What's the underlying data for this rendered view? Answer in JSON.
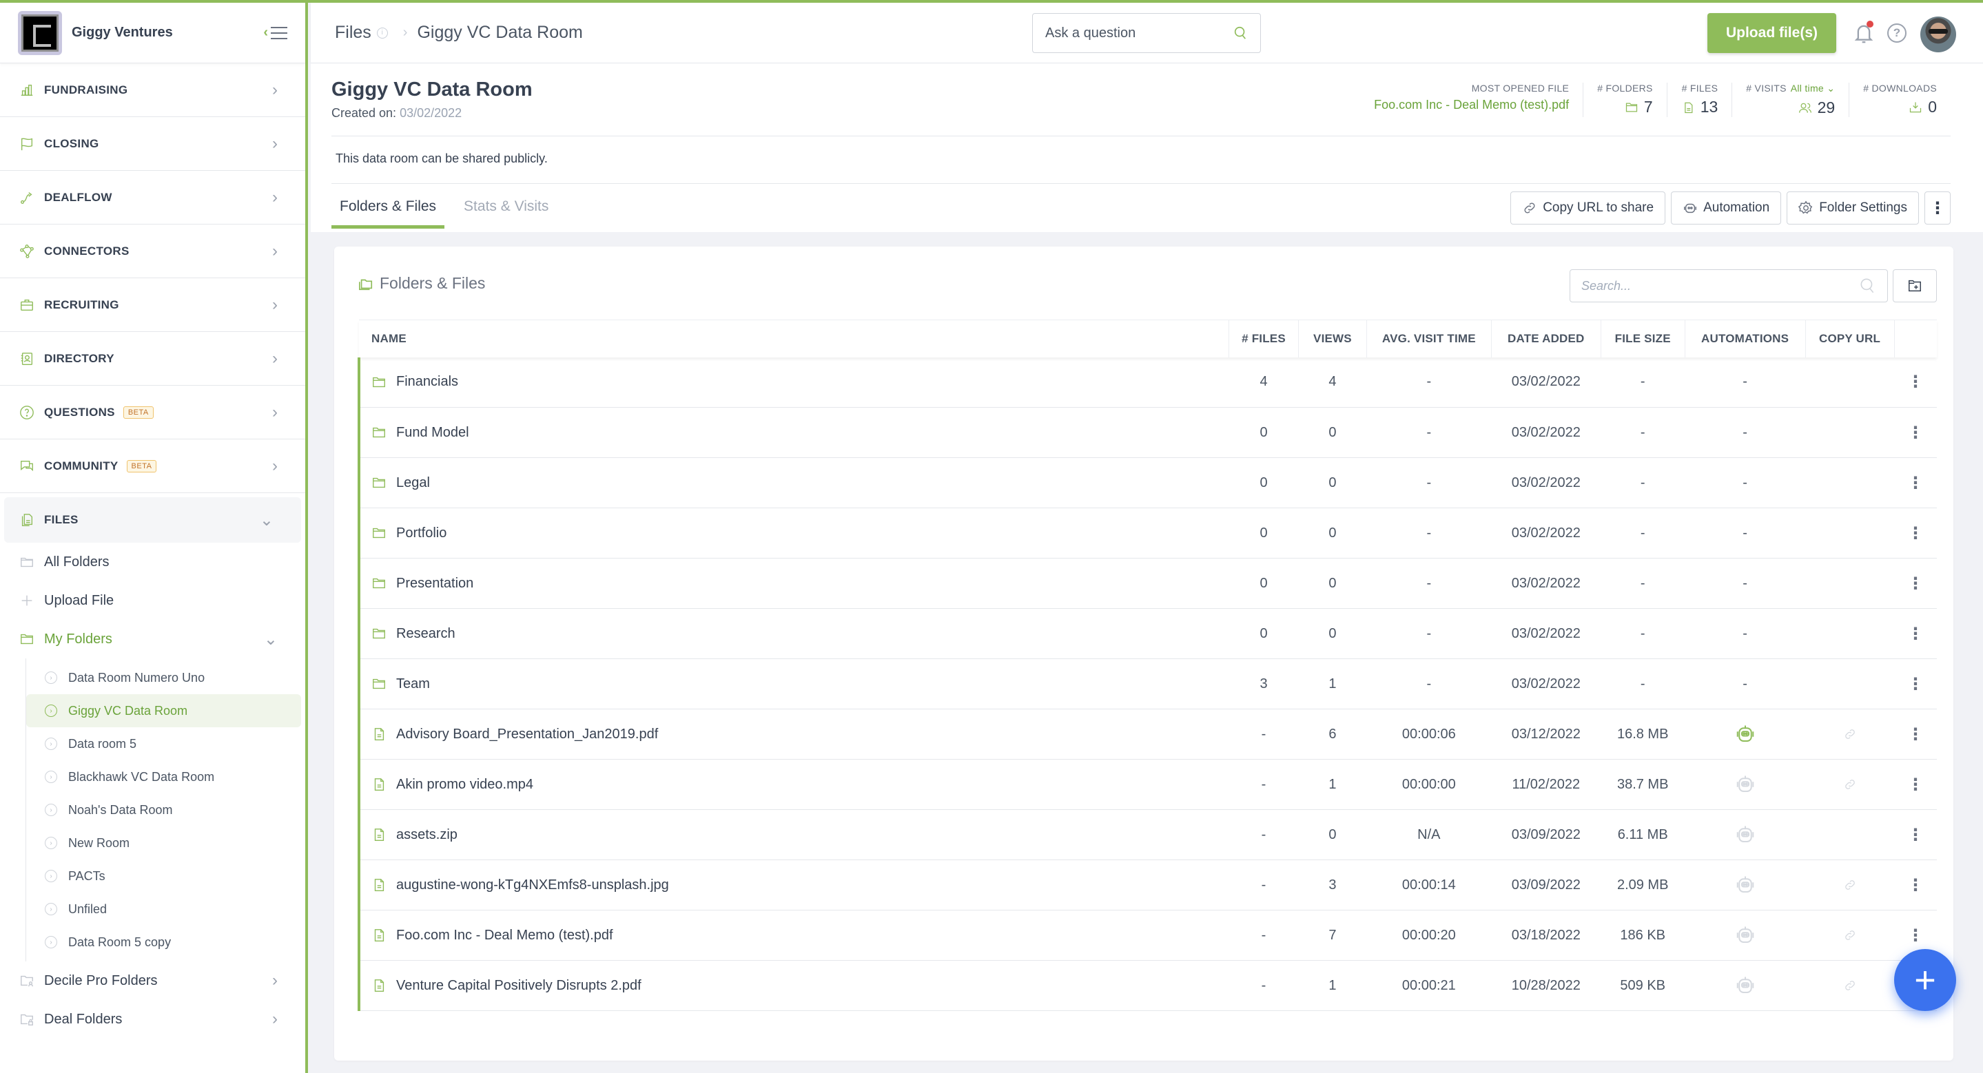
{
  "brand": {
    "name": "Giggy Ventures"
  },
  "sidebar": {
    "nav": [
      {
        "label": "FUNDRAISING",
        "icon": "bar-chart-icon"
      },
      {
        "label": "CLOSING",
        "icon": "flag-icon"
      },
      {
        "label": "DEALFLOW",
        "icon": "route-icon"
      },
      {
        "label": "CONNECTORS",
        "icon": "network-icon"
      },
      {
        "label": "RECRUITING",
        "icon": "briefcase-icon"
      },
      {
        "label": "DIRECTORY",
        "icon": "contact-book-icon"
      },
      {
        "label": "QUESTIONS",
        "icon": "question-circle-icon",
        "badge": "BETA"
      },
      {
        "label": "COMMUNITY",
        "icon": "chat-icon",
        "badge": "BETA"
      },
      {
        "label": "FILES",
        "icon": "files-icon"
      }
    ],
    "files_sub": {
      "all_folders": "All Folders",
      "upload_file": "Upload File",
      "my_folders": "My Folders",
      "rooms": [
        "Data Room Numero Uno",
        "Giggy VC Data Room",
        "Data room 5",
        "Blackhawk VC Data Room",
        "Noah's Data Room",
        "New Room",
        "PACTs",
        "Unfiled",
        "Data Room 5 copy"
      ],
      "active_room": "Giggy VC Data Room",
      "decile_pro": "Decile Pro Folders",
      "deal_folders": "Deal Folders"
    }
  },
  "header": {
    "breadcrumb": [
      "Files",
      "Giggy VC Data Room"
    ],
    "ask_placeholder": "Ask a question",
    "upload_label": "Upload file(s)"
  },
  "page": {
    "title": "Giggy VC Data Room",
    "created_label": "Created on:",
    "created_date": "03/02/2022",
    "share_note": "This data room can be shared publicly.",
    "stats": {
      "most_opened_label": "MOST OPENED FILE",
      "most_opened_value": "Foo.com Inc - Deal Memo (test).pdf",
      "folders_label": "# FOLDERS",
      "folders_value": "7",
      "files_label": "# FILES",
      "files_value": "13",
      "visits_label": "# VISITS",
      "visits_filter": "All time",
      "visits_value": "29",
      "downloads_label": "# DOWNLOADS",
      "downloads_value": "0"
    },
    "tabs": [
      "Folders & Files",
      "Stats & Visits"
    ],
    "active_tab": "Folders & Files",
    "actions": {
      "copy_url": "Copy URL to share",
      "automation": "Automation",
      "folder_settings": "Folder Settings"
    }
  },
  "card": {
    "title": "Folders & Files",
    "search_placeholder": "Search...",
    "columns": [
      "NAME",
      "# FILES",
      "VIEWS",
      "AVG. VISIT TIME",
      "DATE ADDED",
      "FILE SIZE",
      "AUTOMATIONS",
      "COPY URL",
      ""
    ],
    "rows": [
      {
        "type": "folder",
        "name": "Financials",
        "files": "4",
        "views": "4",
        "avg": "-",
        "date": "03/02/2022",
        "size": "-",
        "automation": "-",
        "copy_url": false
      },
      {
        "type": "folder",
        "name": "Fund Model",
        "files": "0",
        "views": "0",
        "avg": "-",
        "date": "03/02/2022",
        "size": "-",
        "automation": "-",
        "copy_url": false
      },
      {
        "type": "folder",
        "name": "Legal",
        "files": "0",
        "views": "0",
        "avg": "-",
        "date": "03/02/2022",
        "size": "-",
        "automation": "-",
        "copy_url": false
      },
      {
        "type": "folder",
        "name": "Portfolio",
        "files": "0",
        "views": "0",
        "avg": "-",
        "date": "03/02/2022",
        "size": "-",
        "automation": "-",
        "copy_url": false
      },
      {
        "type": "folder",
        "name": "Presentation",
        "files": "0",
        "views": "0",
        "avg": "-",
        "date": "03/02/2022",
        "size": "-",
        "automation": "-",
        "copy_url": false
      },
      {
        "type": "folder",
        "name": "Research",
        "files": "0",
        "views": "0",
        "avg": "-",
        "date": "03/02/2022",
        "size": "-",
        "automation": "-",
        "copy_url": false
      },
      {
        "type": "folder",
        "name": "Team",
        "files": "3",
        "views": "1",
        "avg": "-",
        "date": "03/02/2022",
        "size": "-",
        "automation": "-",
        "copy_url": false
      },
      {
        "type": "file",
        "name": "Advisory Board_Presentation_Jan2019.pdf",
        "files": "-",
        "views": "6",
        "avg": "00:00:06",
        "date": "03/12/2022",
        "size": "16.8 MB",
        "automation": "on",
        "copy_url": true
      },
      {
        "type": "file",
        "name": "Akin promo video.mp4",
        "files": "-",
        "views": "1",
        "avg": "00:00:00",
        "date": "11/02/2022",
        "size": "38.7 MB",
        "automation": "off",
        "copy_url": true
      },
      {
        "type": "file",
        "name": "assets.zip",
        "files": "-",
        "views": "0",
        "avg": "N/A",
        "date": "03/09/2022",
        "size": "6.11 MB",
        "automation": "off",
        "copy_url": false
      },
      {
        "type": "file",
        "name": "augustine-wong-kTg4NXEmfs8-unsplash.jpg",
        "files": "-",
        "views": "3",
        "avg": "00:00:14",
        "date": "03/09/2022",
        "size": "2.09 MB",
        "automation": "off",
        "copy_url": true
      },
      {
        "type": "file",
        "name": "Foo.com Inc - Deal Memo (test).pdf",
        "files": "-",
        "views": "7",
        "avg": "00:00:20",
        "date": "03/18/2022",
        "size": "186 KB",
        "automation": "off",
        "copy_url": true
      },
      {
        "type": "file",
        "name": "Venture Capital Positively Disrupts 2.pdf",
        "files": "-",
        "views": "1",
        "avg": "00:00:21",
        "date": "10/28/2022",
        "size": "509 KB",
        "automation": "off",
        "copy_url": true
      }
    ]
  },
  "colors": {
    "accent": "#8fbc5a",
    "accent_text": "#6aa33a",
    "fab": "#3b72ee",
    "badge": "#c2742b",
    "notification": "#e04848"
  }
}
